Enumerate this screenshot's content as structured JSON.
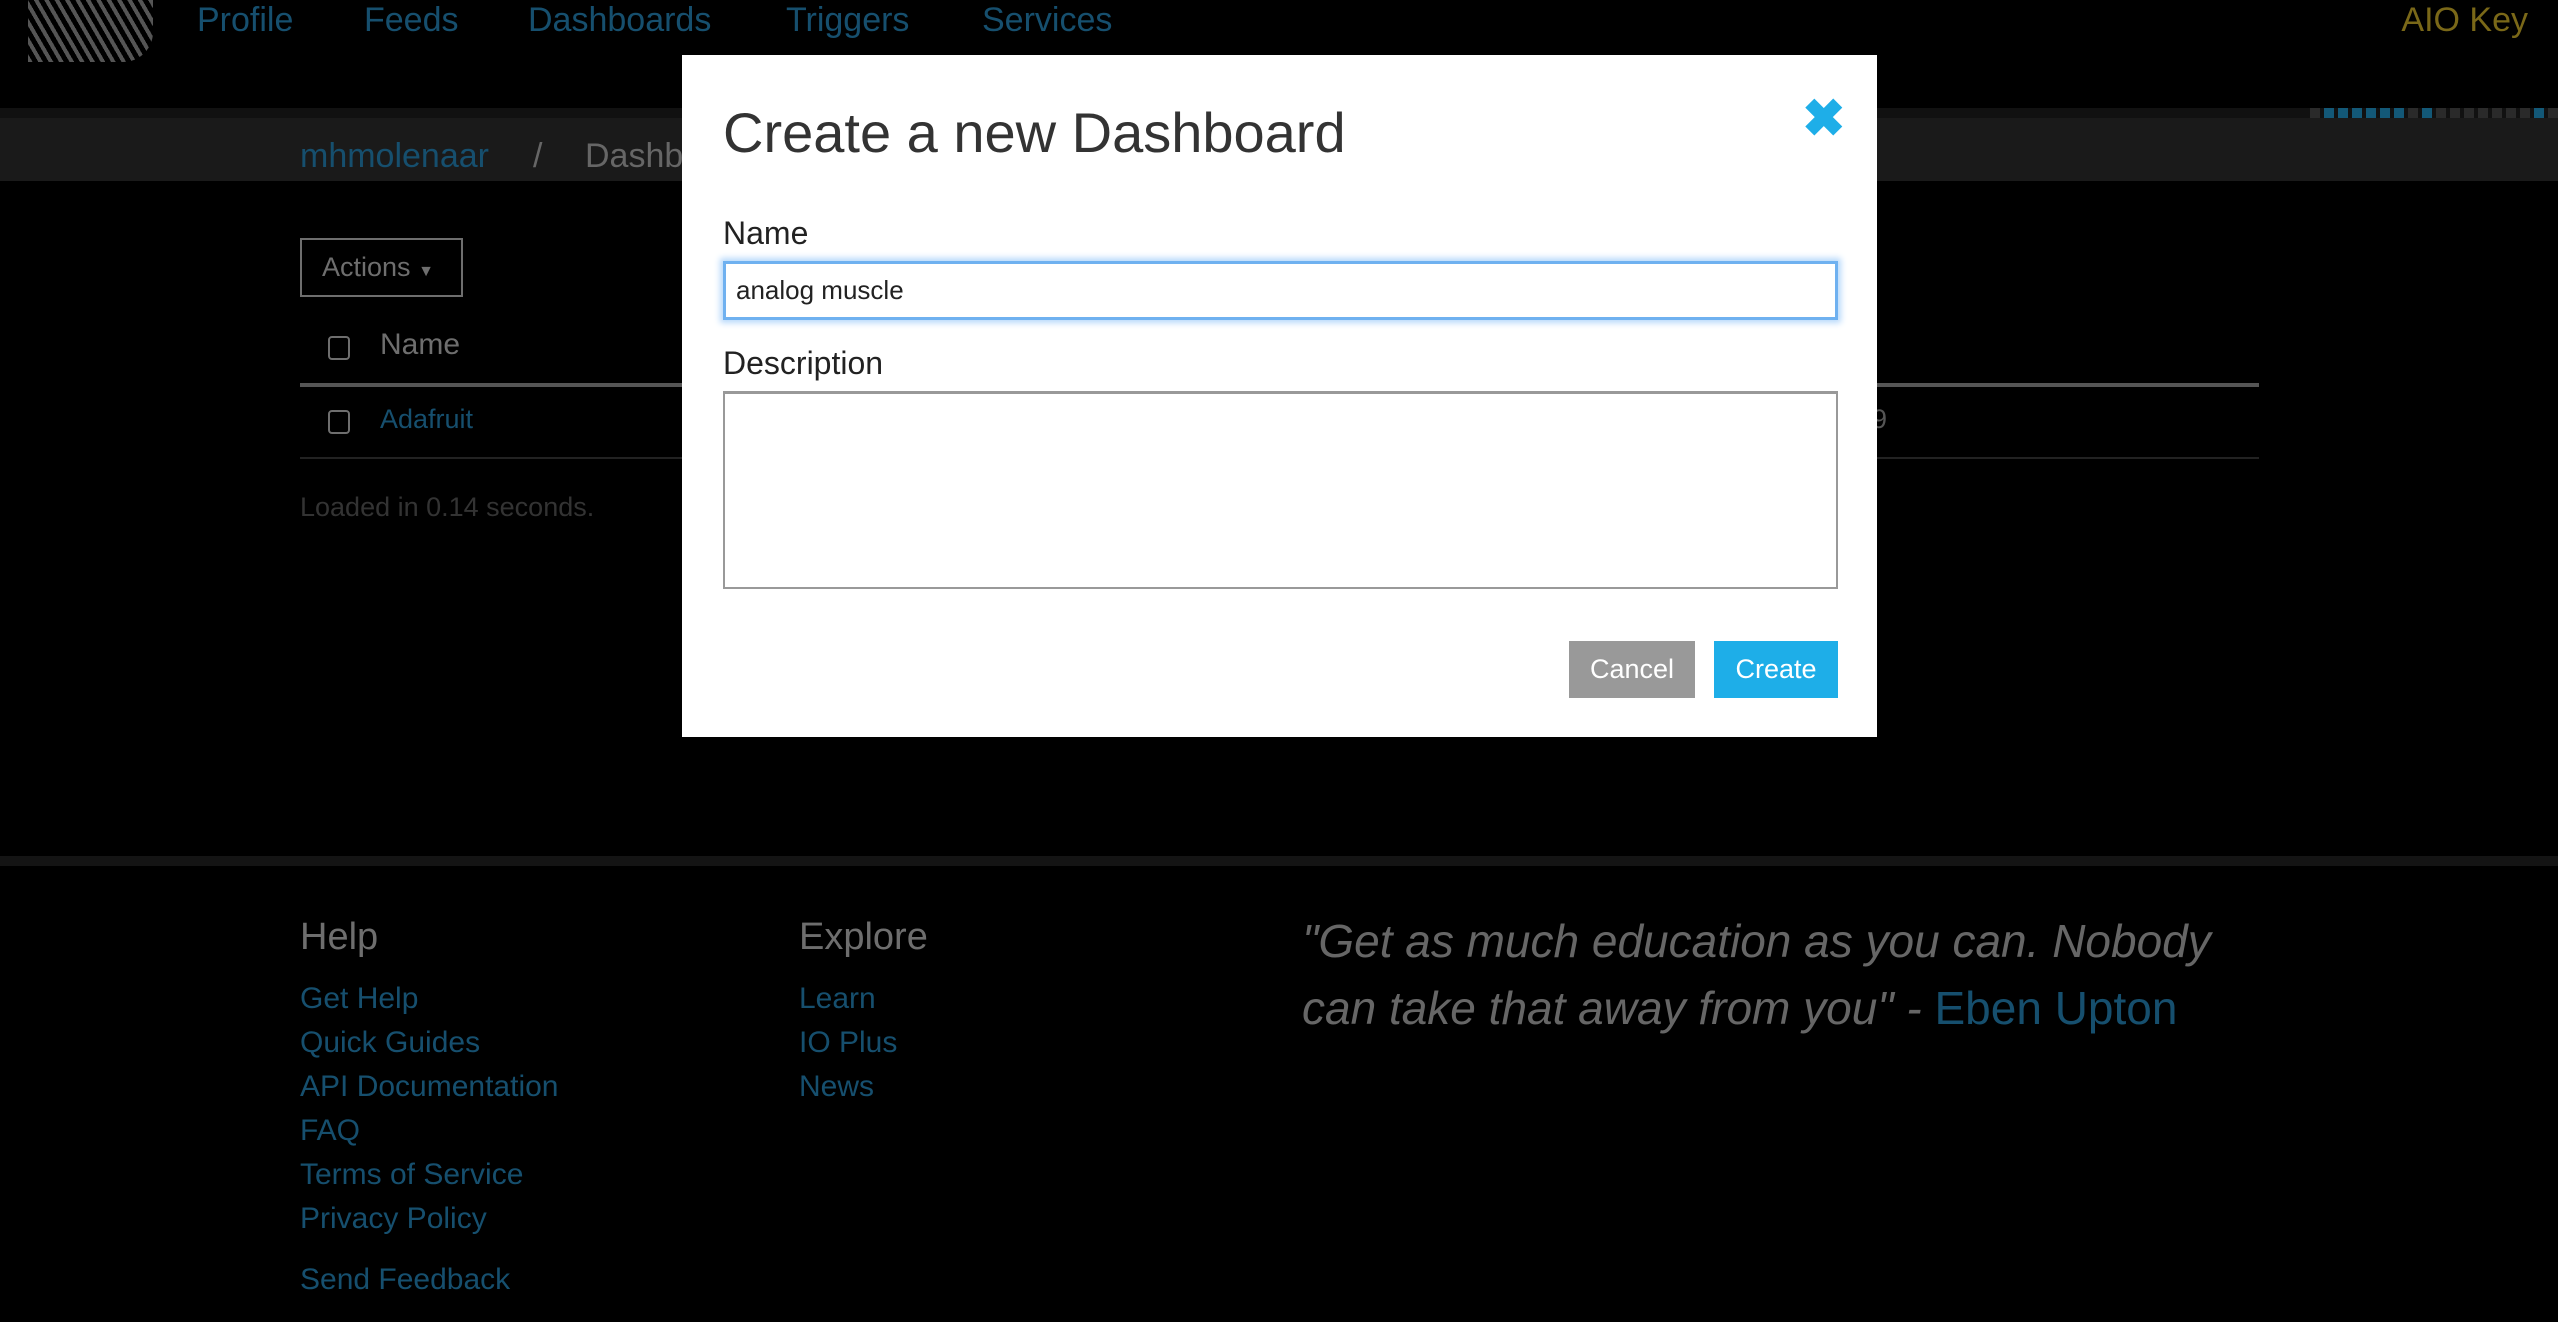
{
  "nav": {
    "items": [
      {
        "label": "Profile"
      },
      {
        "label": "Feeds"
      },
      {
        "label": "Dashboards"
      },
      {
        "label": "Triggers"
      },
      {
        "label": "Services"
      }
    ],
    "aio_key": "AIO Key"
  },
  "breadcrumb": {
    "user": "mhmolenaar",
    "separator": "/",
    "current": "Dashb"
  },
  "progress_pattern": [
    "off",
    "on",
    "on",
    "on",
    "on",
    "on",
    "on",
    "off",
    "on",
    "off",
    "off",
    "off",
    "off",
    "off",
    "off",
    "off",
    "on",
    "off"
  ],
  "colors": {
    "accent": "#1eaee8",
    "link": "#164f6e",
    "aio_key": "#7a6818"
  },
  "list": {
    "actions_label": "Actions",
    "header_name": "Name",
    "rows": [
      {
        "name": "Adafruit",
        "trailing": "9"
      }
    ],
    "loaded": "Loaded in 0.14 seconds."
  },
  "footer": {
    "help_title": "Help",
    "help_links": [
      "Get Help",
      "Quick Guides",
      "API Documentation",
      "FAQ",
      "Terms of Service",
      "Privacy Policy"
    ],
    "feedback": "Send Feedback",
    "explore_title": "Explore",
    "explore_links": [
      "Learn",
      "IO Plus",
      "News"
    ],
    "quote": "\"Get as much education as you can. Nobody can take that away from you\" - ",
    "quote_author": "Eben Upton"
  },
  "modal": {
    "title": "Create a new Dashboard",
    "close_icon": "close-icon",
    "name_label": "Name",
    "name_value": "analog muscle",
    "description_label": "Description",
    "description_value": "",
    "cancel": "Cancel",
    "create": "Create"
  }
}
